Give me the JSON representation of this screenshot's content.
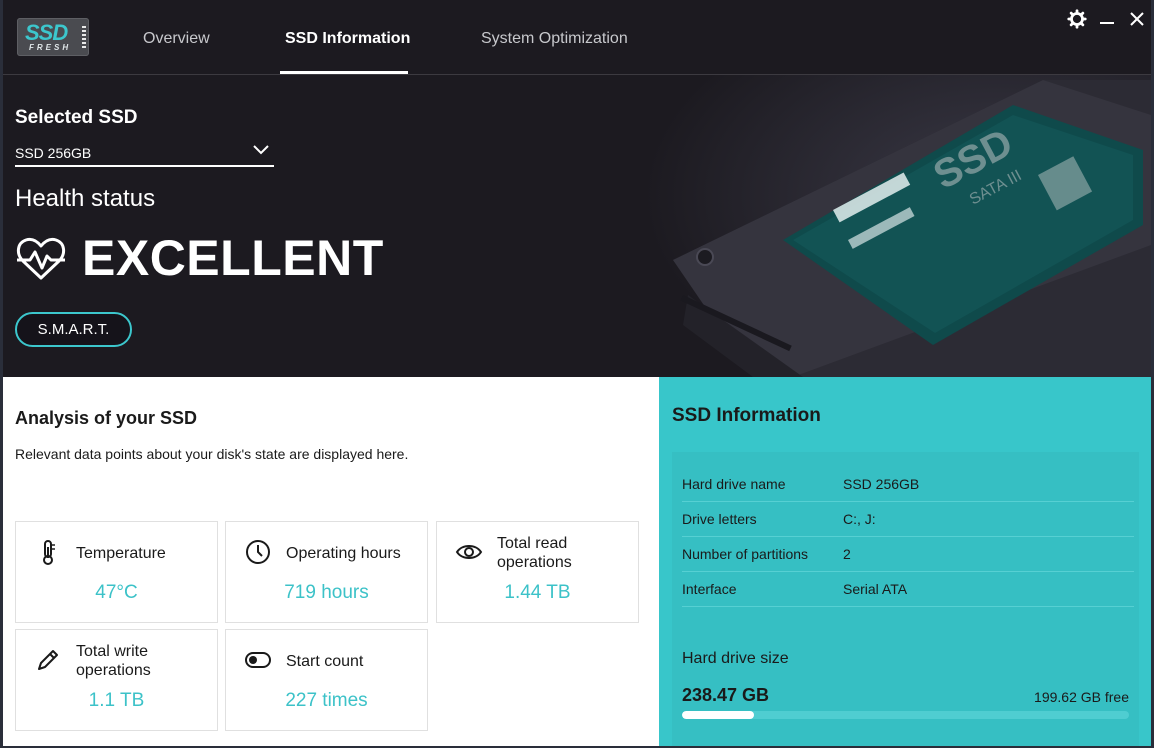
{
  "app": {
    "logo_primary": "SSD",
    "logo_secondary": "FRESH"
  },
  "tabs": [
    {
      "label": "Overview",
      "active": false
    },
    {
      "label": "SSD Information",
      "active": true
    },
    {
      "label": "System Optimization",
      "active": false
    }
  ],
  "window_controls": [
    "gear-icon",
    "minimize-icon",
    "close-icon"
  ],
  "hero": {
    "selected_title": "Selected SSD",
    "selected_value": "SSD 256GB",
    "health_title": "Health status",
    "health_value": "EXCELLENT",
    "smart_button": "S.M.A.R.T.",
    "art_text_main": "SSD",
    "art_text_sub": "SATA III"
  },
  "analysis": {
    "title": "Analysis of your SSD",
    "description": "Relevant data points about your disk's state are displayed here.",
    "cards": [
      {
        "label": "Temperature",
        "value": "47°C",
        "icon": "thermometer-icon"
      },
      {
        "label": "Operating hours",
        "value": "719 hours",
        "icon": "clock-icon"
      },
      {
        "label": "Total read operations",
        "value": "1.44 TB",
        "icon": "eye-icon"
      },
      {
        "label": "Total write operations",
        "value": "1.1 TB",
        "icon": "pencil-icon"
      },
      {
        "label": "Start count",
        "value": "227 times",
        "icon": "toggle-icon"
      }
    ]
  },
  "info": {
    "title": "SSD Information",
    "rows": [
      {
        "label": "Hard drive name",
        "value": "SSD 256GB"
      },
      {
        "label": "Drive letters",
        "value": "C:, J:"
      },
      {
        "label": "Number of partitions",
        "value": "2"
      },
      {
        "label": "Interface",
        "value": "Serial ATA"
      }
    ],
    "size_label": "Hard drive size",
    "size_value": "238.47 GB",
    "free_value": "199.62 GB free",
    "used_fraction": 0.16
  },
  "colors": {
    "accent": "#3cc7cd",
    "dark_bg": "#1c1a20",
    "info_bg": "#38c6ca"
  }
}
